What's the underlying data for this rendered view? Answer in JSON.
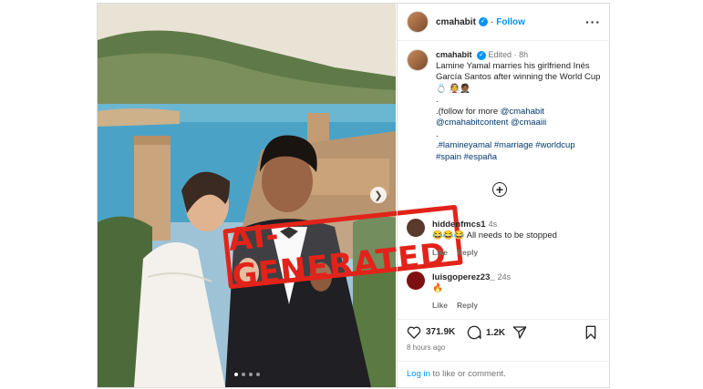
{
  "post": {
    "username": "cmahabit",
    "follow_label": "Follow",
    "caption": {
      "username": "cmahabit",
      "edited": "Edited",
      "time": "8h",
      "text": "Lamine Yamal marries his girlfriend Inés García Santos after winning the World Cup 💍 👰🤵🏾",
      "dot1": ".",
      "follow_prefix": ".(follow for more",
      "mention1": "@cmahabit",
      "mention2": "@cmahabitcontent",
      "mention3": "@cmaaiii",
      "dot2": ".",
      "hashtags_line1": ".#lamineyamal #marriage #worldcup",
      "hashtags_line2": "#spain #españa"
    },
    "stamp_text": "AI-GENERATED",
    "comments": [
      {
        "user": "hiddenfmcs1",
        "time": "4s",
        "text": "😂😂😂 All needs to be stopped",
        "like": "Like",
        "reply": "Reply"
      },
      {
        "user": "luisgoperez23_",
        "time": "24s",
        "text": "🔥",
        "like": "Like",
        "reply": "Reply"
      }
    ],
    "likes": "371.9K",
    "comments_count": "1.2K",
    "time_ago": "8 hours ago",
    "login_link": "Log in",
    "login_suffix": " to like or comment."
  },
  "icons": [
    "heart-icon",
    "comment-icon",
    "share-icon",
    "bookmark-icon",
    "more-icon",
    "add-comment-icon",
    "verified-icon",
    "next-arrow-icon"
  ],
  "colors": {
    "accent": "#0095f6",
    "stamp": "#e2231a",
    "border": "#dbdbdb"
  }
}
